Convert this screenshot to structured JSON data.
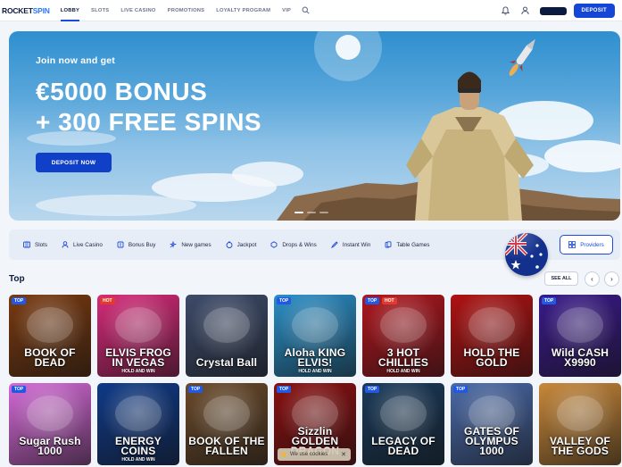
{
  "header": {
    "logo_part1": "ROCKET",
    "logo_part2": "SPIN",
    "nav": [
      "LOBBY",
      "SLOTS",
      "LIVE CASINO",
      "PROMOTIONS",
      "LOYALTY PROGRAM",
      "VIP"
    ],
    "active_nav": "LOBBY",
    "deposit_label": "DEPOSIT"
  },
  "hero": {
    "kicker": "Join now and get",
    "title_line1": "€5000 BONUS",
    "title_line2": "+ 300 FREE SPINS",
    "button_label": "DEPOSIT NOW",
    "slide_count": 3,
    "active_slide": 1
  },
  "categories": [
    {
      "label": "Slots",
      "icon": "slots-icon"
    },
    {
      "label": "Live Casino",
      "icon": "live-casino-icon"
    },
    {
      "label": "Bonus Buy",
      "icon": "bonus-buy-icon"
    },
    {
      "label": "New games",
      "icon": "new-games-icon"
    },
    {
      "label": "Jackpot",
      "icon": "jackpot-icon"
    },
    {
      "label": "Drops & Wins",
      "icon": "drops-wins-icon"
    },
    {
      "label": "Instant Win",
      "icon": "instant-win-icon"
    },
    {
      "label": "Table Games",
      "icon": "table-games-icon"
    }
  ],
  "providers_label": "Providers",
  "section": {
    "title": "Top",
    "see_all": "SEE ALL"
  },
  "games": [
    {
      "title": "BOOK OF DEAD",
      "subtitle": "",
      "badge": "TOP",
      "badge2": "",
      "bg": "#7a3a10"
    },
    {
      "title": "ELVIS FROG IN VEGAS",
      "subtitle": "HOLD AND WIN",
      "badge": "HOT",
      "badge2": "",
      "bg": "#d82a7a"
    },
    {
      "title": "Crystal Ball",
      "subtitle": "",
      "badge": "",
      "badge2": "",
      "bg": "#3d4b6a"
    },
    {
      "title": "Aloha KING ELVIS!",
      "subtitle": "HOLD AND WIN",
      "badge": "TOP",
      "badge2": "",
      "bg": "#2a8fc8"
    },
    {
      "title": "3 HOT CHILLIES",
      "subtitle": "HOLD AND WIN",
      "badge": "TOP",
      "badge2": "HOT",
      "bg": "#b0161e"
    },
    {
      "title": "HOLD THE GOLD",
      "subtitle": "",
      "badge": "",
      "badge2": "",
      "bg": "#b01212"
    },
    {
      "title": "Wild CASH X9990",
      "subtitle": "",
      "badge": "TOP",
      "badge2": "",
      "bg": "#3a1a8a"
    },
    {
      "title": "Sugar Rush 1000",
      "subtitle": "",
      "badge": "TOP",
      "badge2": "",
      "bg": "#d56ad8"
    },
    {
      "title": "ENERGY COINS",
      "subtitle": "HOLD AND WIN",
      "badge": "",
      "badge2": "",
      "bg": "#0f3a88"
    },
    {
      "title": "BOOK OF THE FALLEN",
      "subtitle": "",
      "badge": "TOP",
      "badge2": "",
      "bg": "#6b4a2a"
    },
    {
      "title": "Sizzlin GOLDEN DRAGON",
      "subtitle": "",
      "badge": "TOP",
      "badge2": "",
      "bg": "#8a0f10"
    },
    {
      "title": "LEGACY OF DEAD",
      "subtitle": "",
      "badge": "TOP",
      "badge2": "",
      "bg": "#1a3a5a"
    },
    {
      "title": "GATES OF OLYMPUS 1000",
      "subtitle": "",
      "badge": "TOP",
      "badge2": "",
      "bg": "#4a6aa8"
    },
    {
      "title": "VALLEY OF THE GODS",
      "subtitle": "",
      "badge": "",
      "badge2": "",
      "bg": "#c8883a"
    }
  ],
  "cookie": {
    "label": "We use cookies",
    "close": "✕"
  },
  "colors": {
    "brand_blue": "#1447d6",
    "navy": "#0b1a3f",
    "page_bg": "#f2f5fa"
  }
}
